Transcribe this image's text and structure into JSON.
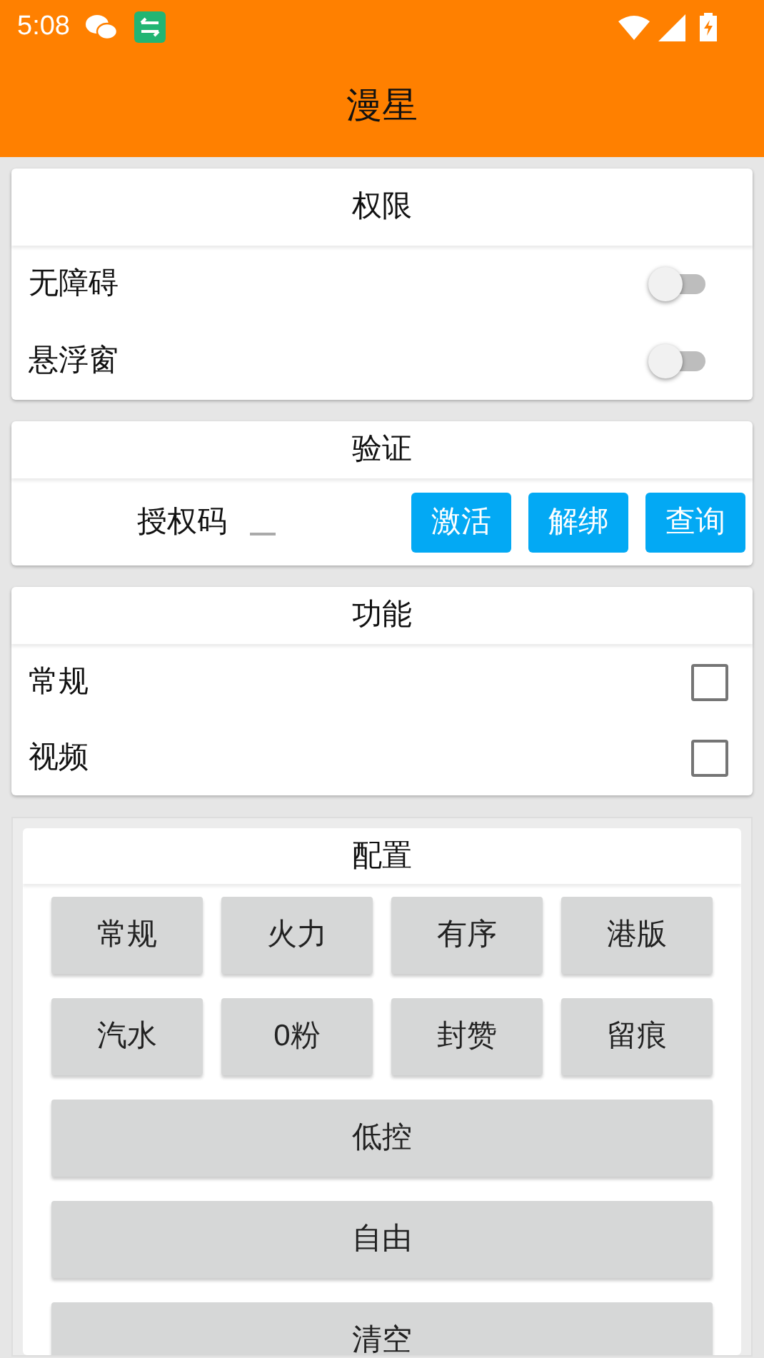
{
  "status_bar": {
    "time": "5:08"
  },
  "app_bar": {
    "title": "漫星"
  },
  "permissions": {
    "title": "权限",
    "items": [
      {
        "label": "无障碍",
        "on": false
      },
      {
        "label": "悬浮窗",
        "on": false
      }
    ]
  },
  "verify": {
    "title": "验证",
    "field_label": "授权码",
    "buttons": [
      "激活",
      "解绑",
      "查询"
    ]
  },
  "features": {
    "title": "功能",
    "items": [
      {
        "label": "常规",
        "checked": false
      },
      {
        "label": "视频",
        "checked": false
      }
    ]
  },
  "config": {
    "title": "配置",
    "buttons": [
      {
        "label": "常规",
        "kind": "grid"
      },
      {
        "label": "火力",
        "kind": "grid"
      },
      {
        "label": "有序",
        "kind": "grid"
      },
      {
        "label": "港版",
        "kind": "grid"
      },
      {
        "label": "汽水",
        "kind": "grid"
      },
      {
        "label": "0粉",
        "kind": "grid"
      },
      {
        "label": "封赞",
        "kind": "grid"
      },
      {
        "label": "留痕",
        "kind": "grid"
      },
      {
        "label": "低控",
        "kind": "wide"
      },
      {
        "label": "自由",
        "kind": "wide"
      },
      {
        "label": "清空",
        "kind": "wide"
      }
    ]
  }
}
